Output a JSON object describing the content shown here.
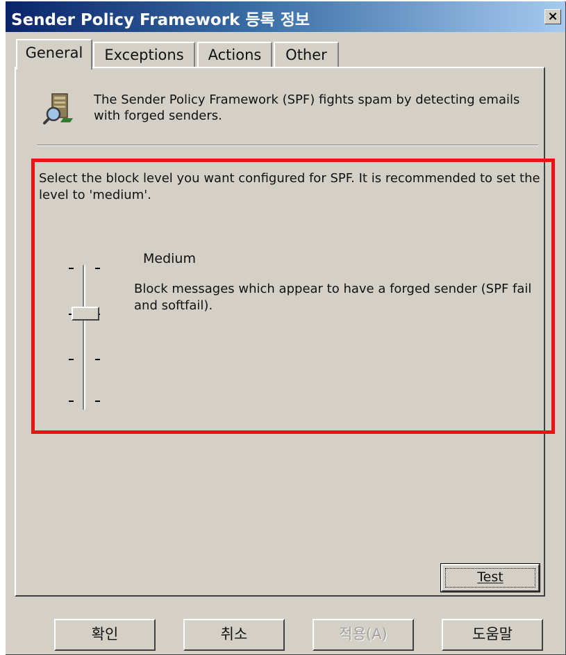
{
  "window": {
    "title": "Sender Policy Framework 등록 정보",
    "close_label": "×"
  },
  "tabs": [
    {
      "label": "General",
      "active": true
    },
    {
      "label": "Exceptions",
      "active": false
    },
    {
      "label": "Actions",
      "active": false
    },
    {
      "label": "Other",
      "active": false
    }
  ],
  "general": {
    "intro_text": "The Sender Policy Framework (SPF) fights spam by detecting emails with forged senders.",
    "select_text": "Select the block level you want configured for SPF.  It is recommended to set the level to 'medium'.",
    "level": {
      "name": "Medium",
      "description": "Block messages which appear to have a forged sender (SPF fail and softfail).",
      "selected_index": 1,
      "total_levels": 4
    },
    "test_button": "Test"
  },
  "footer": {
    "ok_label": "확인",
    "cancel_label": "취소",
    "apply_label": "적용(A)",
    "help_label": "도움말"
  },
  "colors": {
    "highlight_border": "#ee1111",
    "dialog_face": "#d4d0c8",
    "titlebar_start": "#0a246a"
  },
  "icons": {
    "spf": "spf-magnifier-server-icon",
    "close": "close-icon"
  }
}
